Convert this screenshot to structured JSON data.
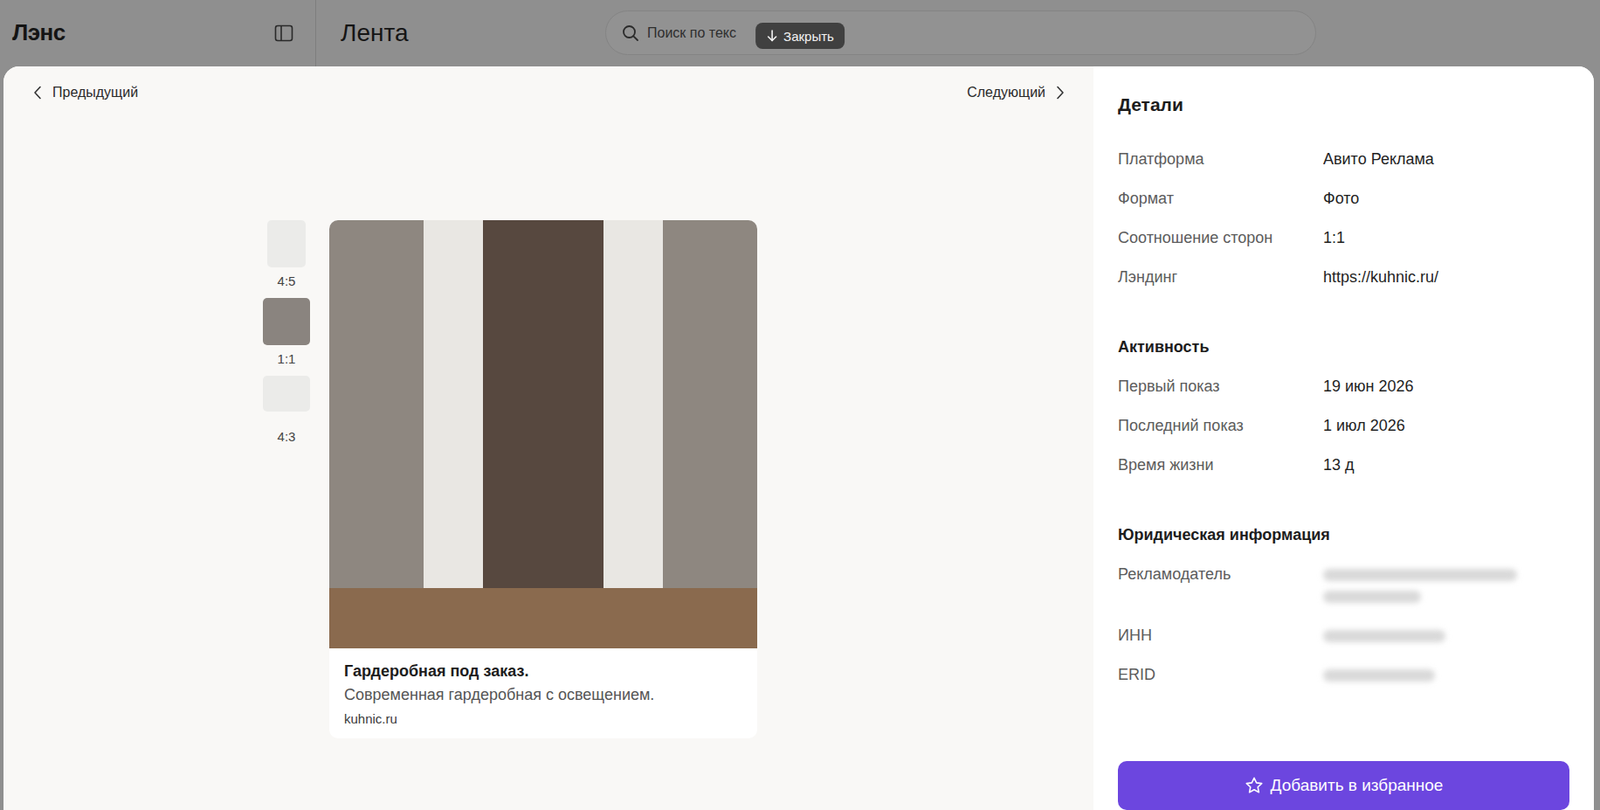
{
  "app": {
    "logo": "Лэнс",
    "page_title": "Лента"
  },
  "search": {
    "placeholder": "Поиск по текс"
  },
  "close_button": {
    "label": "Закрыть"
  },
  "nav": {
    "previous": "Предыдущий",
    "next": "Следующий"
  },
  "ratios": [
    {
      "label": "4:5",
      "selected": false
    },
    {
      "label": "1:1",
      "selected": true
    },
    {
      "label": "4:3",
      "selected": false
    }
  ],
  "ad": {
    "title": "Гардеробная под заказ.",
    "description": "Современная гардеробная с освещением.",
    "domain": "kuhnic.ru"
  },
  "details": {
    "title": "Детали",
    "rows": [
      {
        "label": "Платформа",
        "value": "Авито Реклама",
        "blurred": false
      },
      {
        "label": "Формат",
        "value": "Фото",
        "blurred": false
      },
      {
        "label": "Соотношение сторон",
        "value": "1:1",
        "blurred": false
      },
      {
        "label": "Лэндинг",
        "value": "https://kuhnic.ru/",
        "blurred": false
      }
    ],
    "sections": [
      {
        "title": "Активность",
        "rows": [
          {
            "label": "Первый показ",
            "value": "19 июн 2026",
            "blurred": false
          },
          {
            "label": "Последний показ",
            "value": "1 июл 2026",
            "blurred": false
          },
          {
            "label": "Время жизни",
            "value": "13 д",
            "blurred": false
          }
        ]
      },
      {
        "title": "Юридическая информация",
        "rows": [
          {
            "label": "Рекламодатель",
            "blurred": true,
            "blur_lines": 2
          },
          {
            "label": "ИНН",
            "blurred": true,
            "blur_lines": 1
          },
          {
            "label": "ERID",
            "blurred": true,
            "blur_lines": 1
          }
        ]
      }
    ]
  },
  "favorite_button": {
    "label": "Добавить в избранное"
  }
}
